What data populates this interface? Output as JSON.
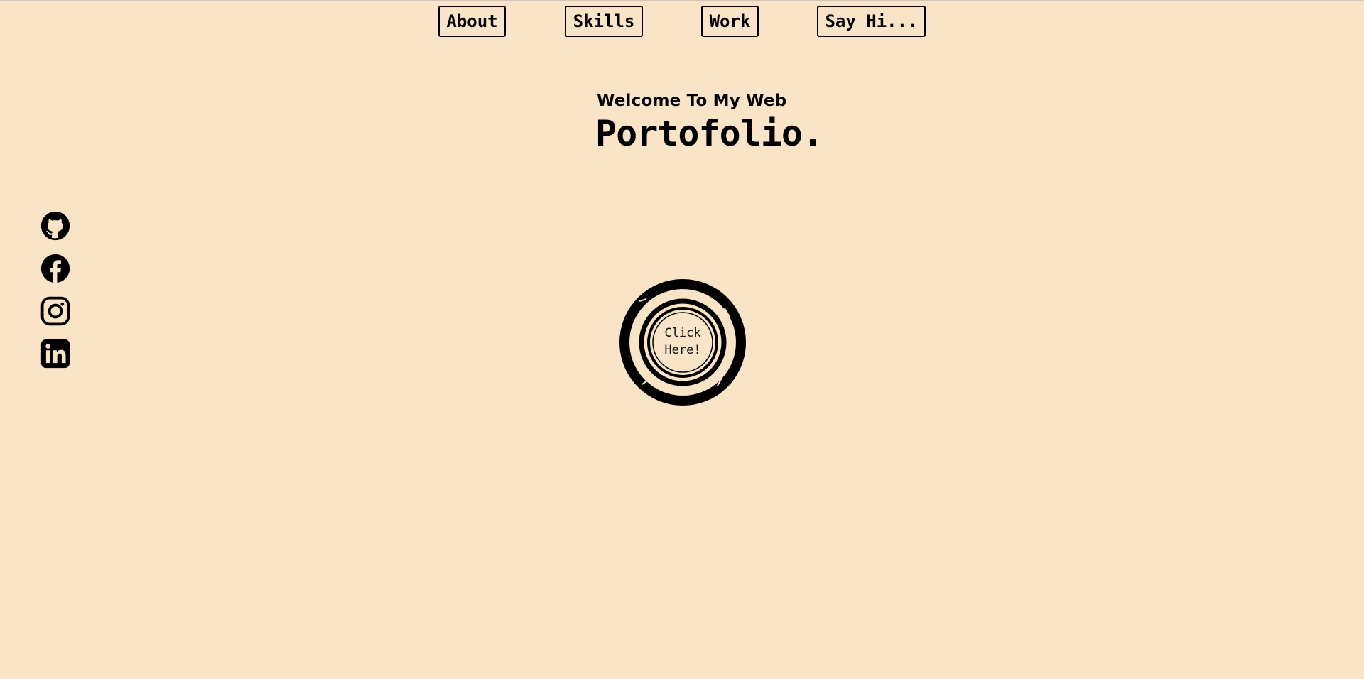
{
  "nav": {
    "items": [
      {
        "label": "About"
      },
      {
        "label": "Skills"
      },
      {
        "label": "Work"
      },
      {
        "label": "Say Hi..."
      }
    ]
  },
  "hero": {
    "welcome": "Welcome To My Web",
    "headline": "Portofolio."
  },
  "socials": [
    {
      "icon": "github-icon"
    },
    {
      "icon": "facebook-icon"
    },
    {
      "icon": "instagram-icon"
    },
    {
      "icon": "linkedin-icon"
    }
  ],
  "cta": {
    "line1": "Click",
    "line2": "Here!"
  },
  "colors": {
    "background": "#fae4c7",
    "foreground": "#000000"
  }
}
